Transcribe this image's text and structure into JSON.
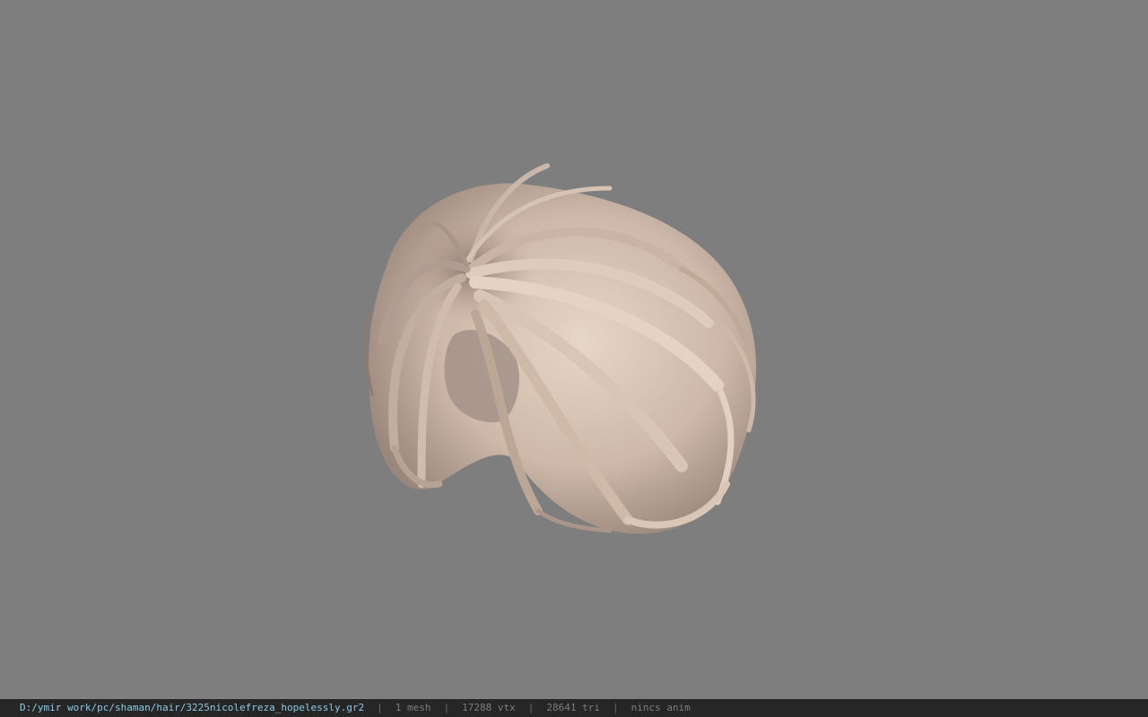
{
  "viewer": {
    "background_color": "#7e7e7e",
    "model_name": "hair mesh",
    "hair_colors": {
      "light": "#e3d2c4",
      "mid": "#c7b2a3",
      "dark": "#8c7a70",
      "shadow": "#6e625c"
    }
  },
  "status_bar": {
    "file_path": "D:/ymir work/pc/shaman/hair/3225nicolefreza_hopelessly.gr2",
    "separator": "|",
    "mesh_count": "1 mesh",
    "vertex_count": "17288 vtx",
    "triangle_count": "28641 tri",
    "anim_status": "nincs anim",
    "path_color": "#8fc8e6",
    "background_color": "#262626"
  }
}
